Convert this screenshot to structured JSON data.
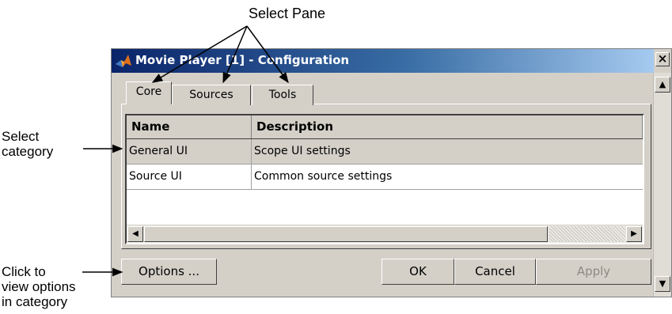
{
  "annotations": {
    "select_pane": "Select Pane",
    "select_category_line1": "Select",
    "select_category_line2": "category",
    "click_options_line1": "Click to",
    "click_options_line2": "view options",
    "click_options_line3": "in category"
  },
  "window": {
    "title": "Movie Player [1] - Configuration",
    "close_glyph": "×",
    "icon": "matlab-logo-icon"
  },
  "tabs": [
    {
      "label": "Core",
      "selected": true
    },
    {
      "label": "Sources",
      "selected": false
    },
    {
      "label": "Tools",
      "selected": false
    }
  ],
  "table": {
    "columns": [
      "Name",
      "Description"
    ],
    "rows": [
      {
        "name": "General UI",
        "description": "Scope UI settings",
        "selected": true
      },
      {
        "name": "Source UI",
        "description": "Common source settings",
        "selected": false
      }
    ]
  },
  "buttons": {
    "options": "Options ...",
    "ok": "OK",
    "cancel": "Cancel",
    "apply": "Apply"
  },
  "colors": {
    "titlebar_start": "#0a246a",
    "titlebar_end": "#a6caf0",
    "dialog_face": "#d4d0c8",
    "disabled_text": "#8d8a84"
  }
}
